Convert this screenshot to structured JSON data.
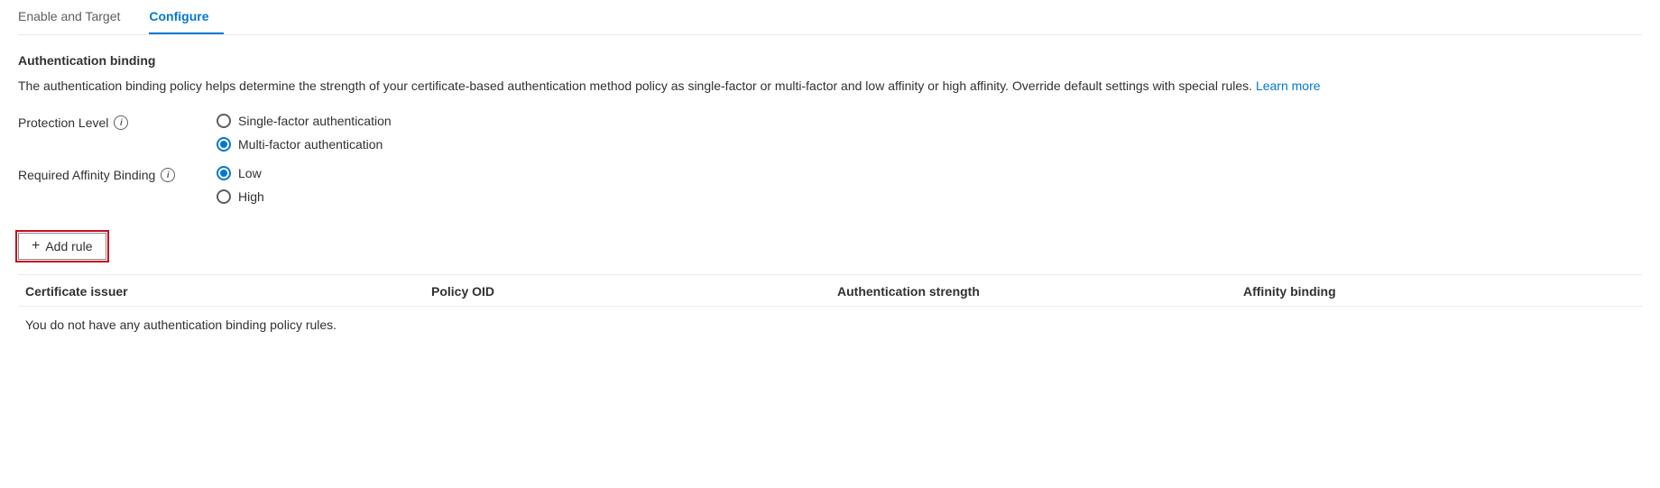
{
  "tabs": [
    {
      "id": "enable-target",
      "label": "Enable and Target",
      "active": false
    },
    {
      "id": "configure",
      "label": "Configure",
      "active": true
    }
  ],
  "section": {
    "title": "Authentication binding",
    "description": "The authentication binding policy helps determine the strength of your certificate-based authentication method policy as single-factor or multi-factor and low affinity or high affinity. Override default settings with special rules.",
    "learn_more_label": "Learn more"
  },
  "protection_level": {
    "label": "Protection Level",
    "options": [
      {
        "id": "single-factor",
        "label": "Single-factor authentication",
        "selected": false
      },
      {
        "id": "multi-factor",
        "label": "Multi-factor authentication",
        "selected": true
      }
    ]
  },
  "affinity_binding": {
    "label": "Required Affinity Binding",
    "options": [
      {
        "id": "low",
        "label": "Low",
        "selected": true
      },
      {
        "id": "high",
        "label": "High",
        "selected": false
      }
    ]
  },
  "add_rule_button": {
    "label": "+ Add rule",
    "plus_symbol": "+"
  },
  "table": {
    "headers": [
      "Certificate issuer",
      "Policy OID",
      "Authentication strength",
      "Affinity binding"
    ],
    "empty_message": "You do not have any authentication binding policy rules."
  }
}
